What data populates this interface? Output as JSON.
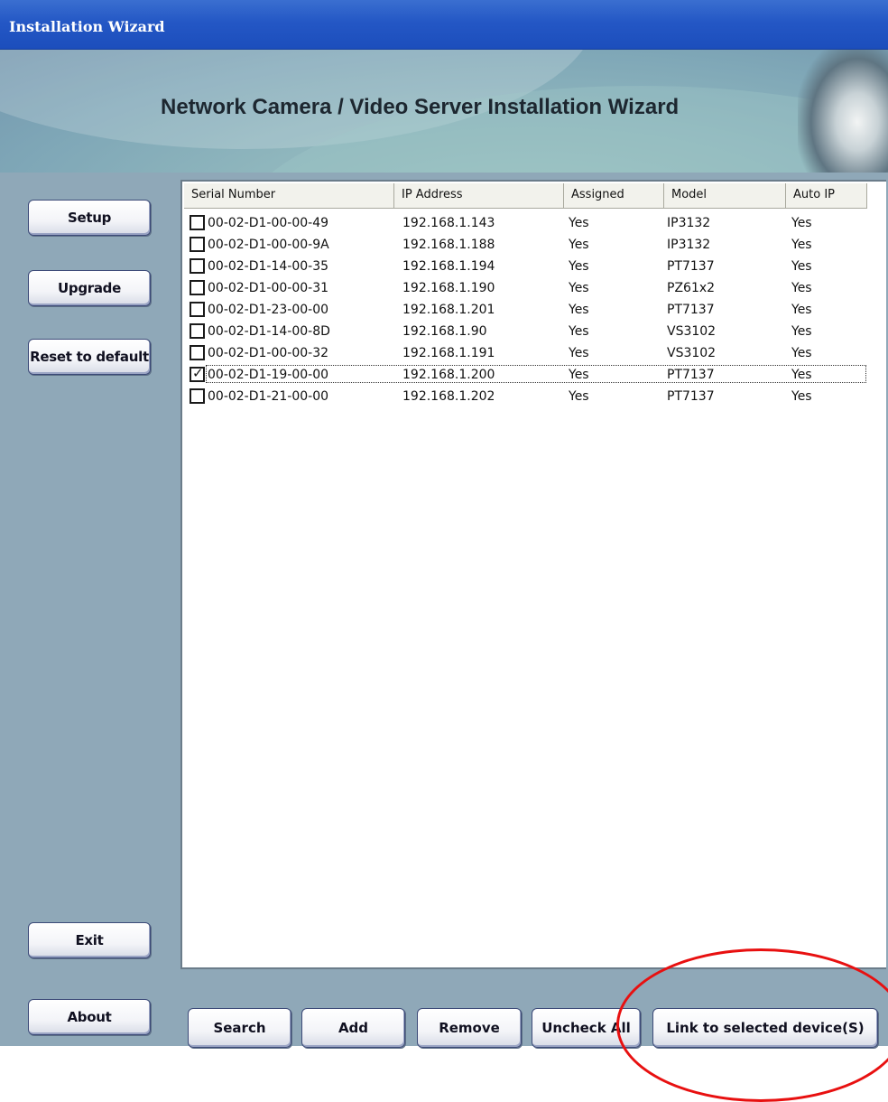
{
  "window": {
    "title": "Installation Wizard"
  },
  "banner": {
    "heading": "Network Camera / Video Server Installation Wizard"
  },
  "sidebar": {
    "setup_label": "Setup",
    "upgrade_label": "Upgrade",
    "reset_label": "Reset to default",
    "exit_label": "Exit",
    "about_label": "About"
  },
  "table": {
    "columns": [
      "Serial Number",
      "IP Address",
      "Assigned",
      "Model",
      "Auto IP"
    ],
    "rows": [
      {
        "checked": false,
        "serial": "00-02-D1-00-00-49",
        "ip": "192.168.1.143",
        "assigned": "Yes",
        "model": "IP3132",
        "auto_ip": "Yes"
      },
      {
        "checked": false,
        "serial": "00-02-D1-00-00-9A",
        "ip": "192.168.1.188",
        "assigned": "Yes",
        "model": "IP3132",
        "auto_ip": "Yes"
      },
      {
        "checked": false,
        "serial": "00-02-D1-14-00-35",
        "ip": "192.168.1.194",
        "assigned": "Yes",
        "model": "PT7137",
        "auto_ip": "Yes"
      },
      {
        "checked": false,
        "serial": "00-02-D1-00-00-31",
        "ip": "192.168.1.190",
        "assigned": "Yes",
        "model": "PZ61x2",
        "auto_ip": "Yes"
      },
      {
        "checked": false,
        "serial": "00-02-D1-23-00-00",
        "ip": "192.168.1.201",
        "assigned": "Yes",
        "model": "PT7137",
        "auto_ip": "Yes"
      },
      {
        "checked": false,
        "serial": "00-02-D1-14-00-8D",
        "ip": "192.168.1.90",
        "assigned": "Yes",
        "model": "VS3102",
        "auto_ip": "Yes"
      },
      {
        "checked": false,
        "serial": "00-02-D1-00-00-32",
        "ip": "192.168.1.191",
        "assigned": "Yes",
        "model": "VS3102",
        "auto_ip": "Yes"
      },
      {
        "checked": true,
        "serial": "00-02-D1-19-00-00",
        "ip": "192.168.1.200",
        "assigned": "Yes",
        "model": "PT7137",
        "auto_ip": "Yes"
      },
      {
        "checked": false,
        "serial": "00-02-D1-21-00-00",
        "ip": "192.168.1.202",
        "assigned": "Yes",
        "model": "PT7137",
        "auto_ip": "Yes"
      }
    ]
  },
  "bottom": {
    "search_label": "Search",
    "add_label": "Add",
    "remove_label": "Remove",
    "uncheck_all_label": "Uncheck All",
    "link_label": "Link to selected device(S)"
  },
  "colors": {
    "titlebar": "#2457c5",
    "panel": "#8fa8b8",
    "annotation": "#e81010"
  }
}
